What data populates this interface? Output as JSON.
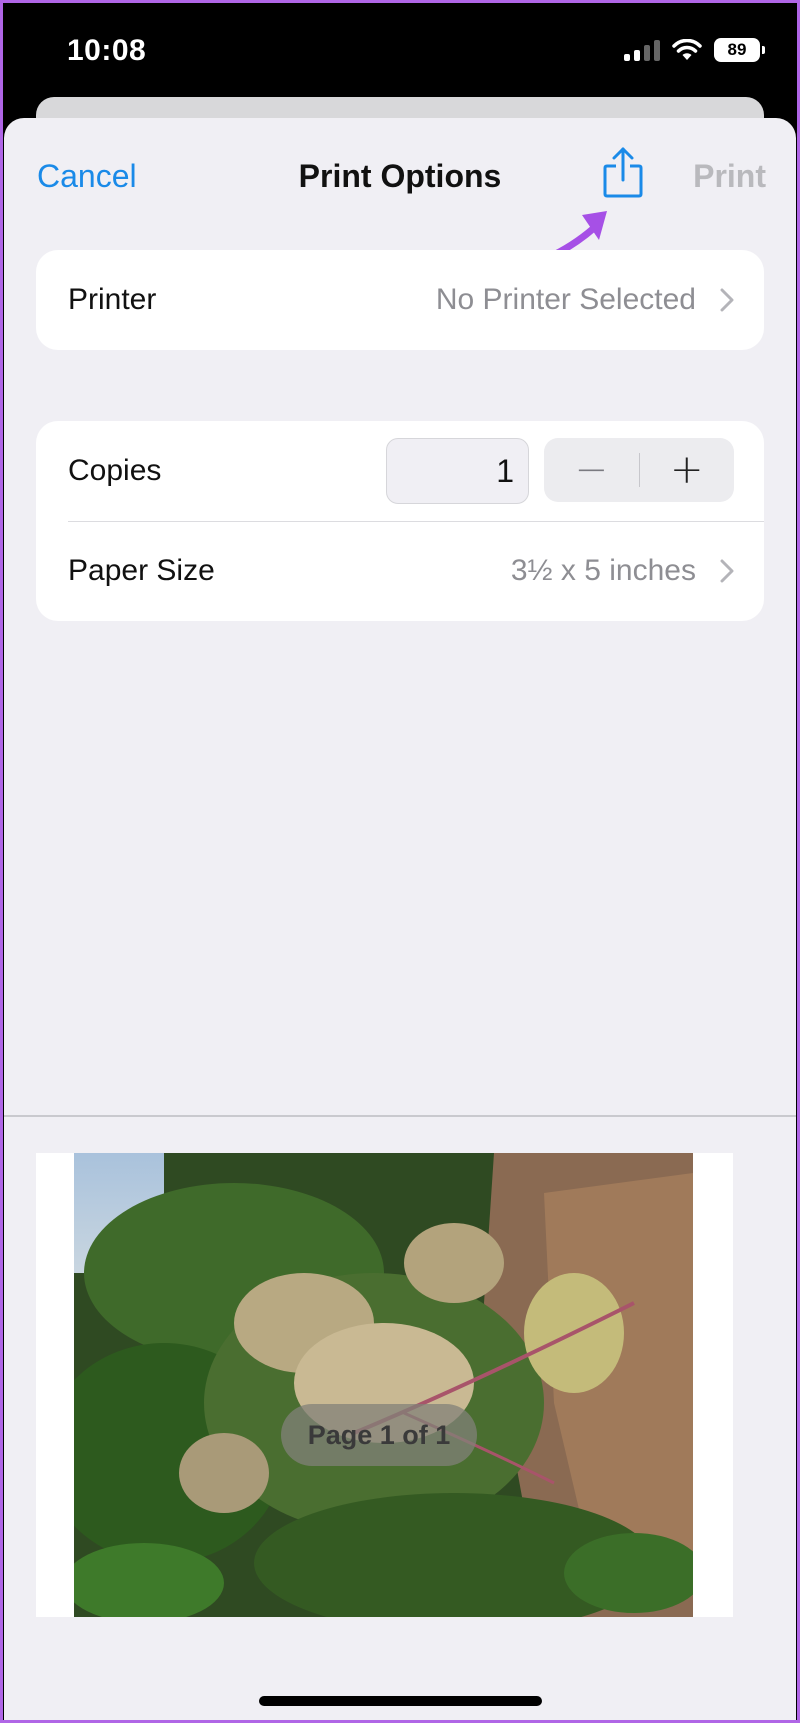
{
  "status_bar": {
    "time": "10:08",
    "battery": "89",
    "icons": [
      "cellular-signal-icon",
      "wifi-icon",
      "battery-icon"
    ]
  },
  "nav": {
    "cancel_label": "Cancel",
    "title": "Print Options",
    "share_icon": "share-icon",
    "print_label": "Print"
  },
  "printer": {
    "label": "Printer",
    "value": "No Printer Selected"
  },
  "copies": {
    "label": "Copies",
    "value": "1",
    "decrement_label": "−",
    "increment_label": "+"
  },
  "paper_size": {
    "label": "Paper Size",
    "value": "3½ x 5 inches"
  },
  "preview": {
    "page_indicator": "Page 1 of 1",
    "image": "mango-blossom-photo"
  },
  "colors": {
    "accent": "#1a8ae8",
    "annotation_arrow": "#a650e6",
    "disabled": "#b9b9bd"
  }
}
